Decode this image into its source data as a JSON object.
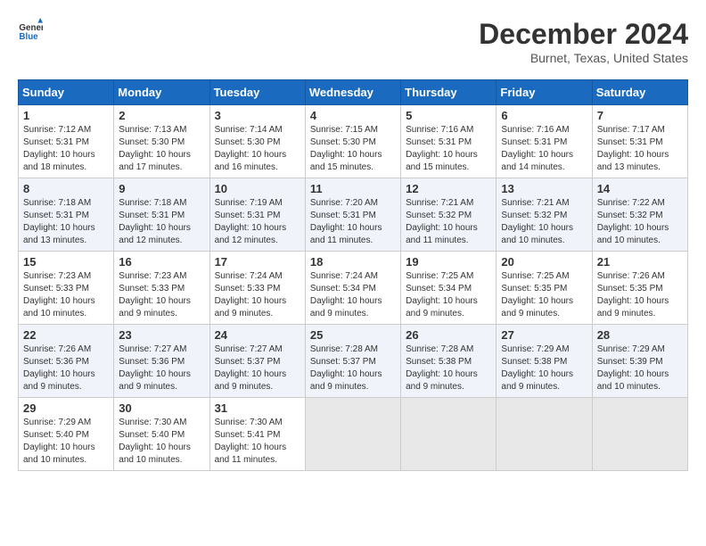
{
  "header": {
    "logo": {
      "general": "General",
      "blue": "Blue"
    },
    "title": "December 2024",
    "location": "Burnet, Texas, United States"
  },
  "calendar": {
    "days_of_week": [
      "Sunday",
      "Monday",
      "Tuesday",
      "Wednesday",
      "Thursday",
      "Friday",
      "Saturday"
    ],
    "weeks": [
      [
        null,
        null,
        null,
        null,
        null,
        null,
        null
      ]
    ],
    "cells": [
      {
        "day": 1,
        "dow": 0,
        "sunrise": "7:12 AM",
        "sunset": "5:31 PM",
        "daylight": "10 hours and 18 minutes."
      },
      {
        "day": 2,
        "dow": 1,
        "sunrise": "7:13 AM",
        "sunset": "5:30 PM",
        "daylight": "10 hours and 17 minutes."
      },
      {
        "day": 3,
        "dow": 2,
        "sunrise": "7:14 AM",
        "sunset": "5:30 PM",
        "daylight": "10 hours and 16 minutes."
      },
      {
        "day": 4,
        "dow": 3,
        "sunrise": "7:15 AM",
        "sunset": "5:30 PM",
        "daylight": "10 hours and 15 minutes."
      },
      {
        "day": 5,
        "dow": 4,
        "sunrise": "7:16 AM",
        "sunset": "5:31 PM",
        "daylight": "10 hours and 15 minutes."
      },
      {
        "day": 6,
        "dow": 5,
        "sunrise": "7:16 AM",
        "sunset": "5:31 PM",
        "daylight": "10 hours and 14 minutes."
      },
      {
        "day": 7,
        "dow": 6,
        "sunrise": "7:17 AM",
        "sunset": "5:31 PM",
        "daylight": "10 hours and 13 minutes."
      },
      {
        "day": 8,
        "dow": 0,
        "sunrise": "7:18 AM",
        "sunset": "5:31 PM",
        "daylight": "10 hours and 13 minutes."
      },
      {
        "day": 9,
        "dow": 1,
        "sunrise": "7:18 AM",
        "sunset": "5:31 PM",
        "daylight": "10 hours and 12 minutes."
      },
      {
        "day": 10,
        "dow": 2,
        "sunrise": "7:19 AM",
        "sunset": "5:31 PM",
        "daylight": "10 hours and 12 minutes."
      },
      {
        "day": 11,
        "dow": 3,
        "sunrise": "7:20 AM",
        "sunset": "5:31 PM",
        "daylight": "10 hours and 11 minutes."
      },
      {
        "day": 12,
        "dow": 4,
        "sunrise": "7:21 AM",
        "sunset": "5:32 PM",
        "daylight": "10 hours and 11 minutes."
      },
      {
        "day": 13,
        "dow": 5,
        "sunrise": "7:21 AM",
        "sunset": "5:32 PM",
        "daylight": "10 hours and 10 minutes."
      },
      {
        "day": 14,
        "dow": 6,
        "sunrise": "7:22 AM",
        "sunset": "5:32 PM",
        "daylight": "10 hours and 10 minutes."
      },
      {
        "day": 15,
        "dow": 0,
        "sunrise": "7:23 AM",
        "sunset": "5:33 PM",
        "daylight": "10 hours and 10 minutes."
      },
      {
        "day": 16,
        "dow": 1,
        "sunrise": "7:23 AM",
        "sunset": "5:33 PM",
        "daylight": "10 hours and 9 minutes."
      },
      {
        "day": 17,
        "dow": 2,
        "sunrise": "7:24 AM",
        "sunset": "5:33 PM",
        "daylight": "10 hours and 9 minutes."
      },
      {
        "day": 18,
        "dow": 3,
        "sunrise": "7:24 AM",
        "sunset": "5:34 PM",
        "daylight": "10 hours and 9 minutes."
      },
      {
        "day": 19,
        "dow": 4,
        "sunrise": "7:25 AM",
        "sunset": "5:34 PM",
        "daylight": "10 hours and 9 minutes."
      },
      {
        "day": 20,
        "dow": 5,
        "sunrise": "7:25 AM",
        "sunset": "5:35 PM",
        "daylight": "10 hours and 9 minutes."
      },
      {
        "day": 21,
        "dow": 6,
        "sunrise": "7:26 AM",
        "sunset": "5:35 PM",
        "daylight": "10 hours and 9 minutes."
      },
      {
        "day": 22,
        "dow": 0,
        "sunrise": "7:26 AM",
        "sunset": "5:36 PM",
        "daylight": "10 hours and 9 minutes."
      },
      {
        "day": 23,
        "dow": 1,
        "sunrise": "7:27 AM",
        "sunset": "5:36 PM",
        "daylight": "10 hours and 9 minutes."
      },
      {
        "day": 24,
        "dow": 2,
        "sunrise": "7:27 AM",
        "sunset": "5:37 PM",
        "daylight": "10 hours and 9 minutes."
      },
      {
        "day": 25,
        "dow": 3,
        "sunrise": "7:28 AM",
        "sunset": "5:37 PM",
        "daylight": "10 hours and 9 minutes."
      },
      {
        "day": 26,
        "dow": 4,
        "sunrise": "7:28 AM",
        "sunset": "5:38 PM",
        "daylight": "10 hours and 9 minutes."
      },
      {
        "day": 27,
        "dow": 5,
        "sunrise": "7:29 AM",
        "sunset": "5:38 PM",
        "daylight": "10 hours and 9 minutes."
      },
      {
        "day": 28,
        "dow": 6,
        "sunrise": "7:29 AM",
        "sunset": "5:39 PM",
        "daylight": "10 hours and 10 minutes."
      },
      {
        "day": 29,
        "dow": 0,
        "sunrise": "7:29 AM",
        "sunset": "5:40 PM",
        "daylight": "10 hours and 10 minutes."
      },
      {
        "day": 30,
        "dow": 1,
        "sunrise": "7:30 AM",
        "sunset": "5:40 PM",
        "daylight": "10 hours and 10 minutes."
      },
      {
        "day": 31,
        "dow": 2,
        "sunrise": "7:30 AM",
        "sunset": "5:41 PM",
        "daylight": "10 hours and 11 minutes."
      }
    ]
  },
  "labels": {
    "sunrise": "Sunrise:",
    "sunset": "Sunset:",
    "daylight": "Daylight:"
  }
}
